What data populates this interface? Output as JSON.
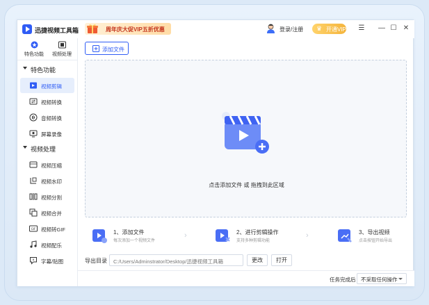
{
  "titlebar": {
    "app_title": "迅捷视频工具箱",
    "promo_text": "周年庆大促VIP五折优惠",
    "login_label": "登录/注册",
    "vip_label": "开通VIP",
    "menu_glyph": "☰",
    "minimize_glyph": "—",
    "maximize_glyph": "☐",
    "close_glyph": "✕"
  },
  "topnav": [
    {
      "label": "特色功能",
      "icon": "star-circle-icon"
    },
    {
      "label": "视频处理",
      "icon": "film-icon"
    }
  ],
  "sidebar": {
    "groups": [
      {
        "label": "特色功能",
        "items": [
          {
            "label": "视频剪辑",
            "icon": "video-edit-icon",
            "active": true
          },
          {
            "label": "视频转换",
            "icon": "video-convert-icon",
            "active": false
          },
          {
            "label": "音频转换",
            "icon": "audio-convert-icon",
            "active": false
          },
          {
            "label": "屏幕录像",
            "icon": "screen-record-icon",
            "active": false
          }
        ]
      },
      {
        "label": "视频处理",
        "items": [
          {
            "label": "视频压缩",
            "icon": "video-compress-icon",
            "active": false
          },
          {
            "label": "视频水印",
            "icon": "video-watermark-icon",
            "active": false
          },
          {
            "label": "视频分割",
            "icon": "video-split-icon",
            "active": false
          },
          {
            "label": "视频合并",
            "icon": "video-merge-icon",
            "active": false
          },
          {
            "label": "视频转GIF",
            "icon": "gif-icon",
            "active": false
          },
          {
            "label": "视频配乐",
            "icon": "music-icon",
            "active": false
          },
          {
            "label": "字幕/贴图",
            "icon": "subtitle-icon",
            "active": false
          }
        ]
      }
    ]
  },
  "main": {
    "add_file_label": "添加文件",
    "drop_text": "点击添加文件 或 拖拽到此区域",
    "steps": [
      {
        "title": "1、添加文件",
        "subtitle": "每次添加一个视频文件"
      },
      {
        "title": "2、进行剪辑操作",
        "subtitle": "支持多种剪辑功能"
      },
      {
        "title": "3、导出视频",
        "subtitle": "点击按钮开始导出"
      }
    ],
    "export": {
      "label": "导出目录",
      "path": "C:/Users/Adminstrator/Desktop/迅捷视频工具箱",
      "change_label": "更改",
      "open_label": "打开"
    }
  },
  "statusbar": {
    "task_label": "任务完成后",
    "task_value": "不采取任何操作"
  },
  "colors": {
    "accent": "#2f5cf5",
    "active_bg": "#e6eefc",
    "promo_text": "#c4341c",
    "vip_gold": "#f4b43c"
  }
}
